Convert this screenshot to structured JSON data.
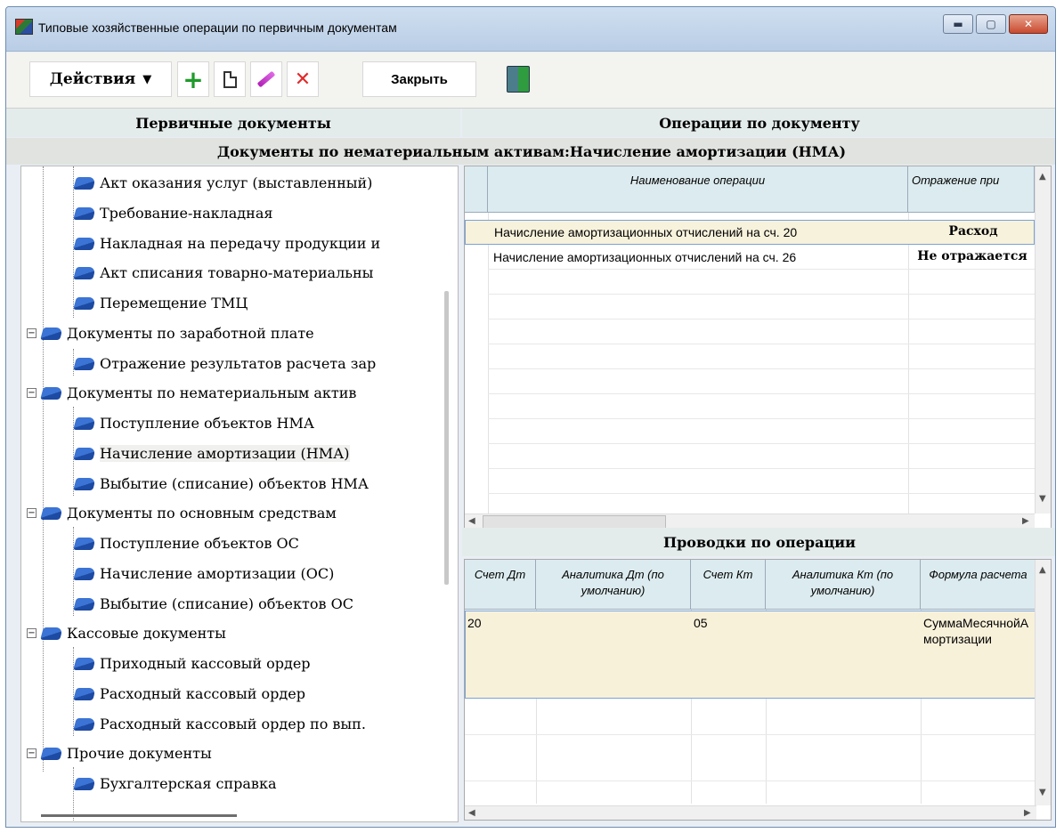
{
  "window": {
    "title": "Типовые хозяйственные операции по первичным документам",
    "minimize": "▬",
    "maximize": "▢",
    "close": "✕"
  },
  "toolbar": {
    "actions_label": "Действия",
    "actions_caret": "▼",
    "add_glyph": "+",
    "delete_glyph": "✕",
    "close_label": "Закрыть"
  },
  "panels": {
    "left_header": "Первичные документы",
    "right_header": "Операции по документу",
    "document_header": "Документы по нематериальным активам:Начисление амортизации (НМА)",
    "postings_header": "Проводки по операции"
  },
  "tree": {
    "items": [
      {
        "label": "Акт оказания услуг (выставленный)",
        "level": 2
      },
      {
        "label": "Требование-накладная",
        "level": 2
      },
      {
        "label": "Накладная на передачу продукции и",
        "level": 2
      },
      {
        "label": "Акт списания товарно-материальны",
        "level": 2
      },
      {
        "label": "Перемещение ТМЦ",
        "level": 2
      },
      {
        "label": "Документы по заработной плате",
        "level": 1,
        "expander": "−"
      },
      {
        "label": "Отражение результатов расчета зар",
        "level": 2
      },
      {
        "label": "Документы по нематериальным актив",
        "level": 1,
        "expander": "−"
      },
      {
        "label": "Поступление объектов НМА",
        "level": 2
      },
      {
        "label": "Начисление амортизации (НМА)",
        "level": 2,
        "selected": true
      },
      {
        "label": "Выбытие (списание) объектов НМА",
        "level": 2
      },
      {
        "label": "Документы по основным средствам",
        "level": 1,
        "expander": "−"
      },
      {
        "label": "Поступление объектов ОС",
        "level": 2
      },
      {
        "label": "Начисление амортизации (ОС)",
        "level": 2
      },
      {
        "label": "Выбытие (списание) объектов ОС",
        "level": 2
      },
      {
        "label": "Кассовые документы",
        "level": 1,
        "expander": "−"
      },
      {
        "label": "Приходный кассовый ордер",
        "level": 2
      },
      {
        "label": "Расходный кассовый ордер",
        "level": 2
      },
      {
        "label": "Расходный кассовый ордер по вып.",
        "level": 2
      },
      {
        "label": "Прочие документы",
        "level": 1,
        "expander": "−"
      },
      {
        "label": "Бухгалтерская справка",
        "level": 2
      }
    ]
  },
  "operations": {
    "columns": [
      "Наименование операции",
      "Отражение при"
    ],
    "rows": [
      {
        "name": "Начисление амортизационных отчислений на сч. 20",
        "reflection": "Расход",
        "selected": true
      },
      {
        "name": "Начисление амортизационных отчислений на сч. 26",
        "reflection": "Не отражается"
      }
    ]
  },
  "postings": {
    "columns": [
      "Счет Дт",
      "Аналитика Дт (по умолчанию)",
      "Счет Кт",
      "Аналитика Кт (по умолчанию)",
      "Формула расчета"
    ],
    "rows": [
      {
        "debit": "20",
        "debit_analytics": "",
        "credit": "05",
        "credit_analytics": "",
        "formula": "СуммаМесячнойАмортизации"
      }
    ]
  },
  "scroll": {
    "up": "▲",
    "down": "▼",
    "left": "◀",
    "right": "▶"
  }
}
